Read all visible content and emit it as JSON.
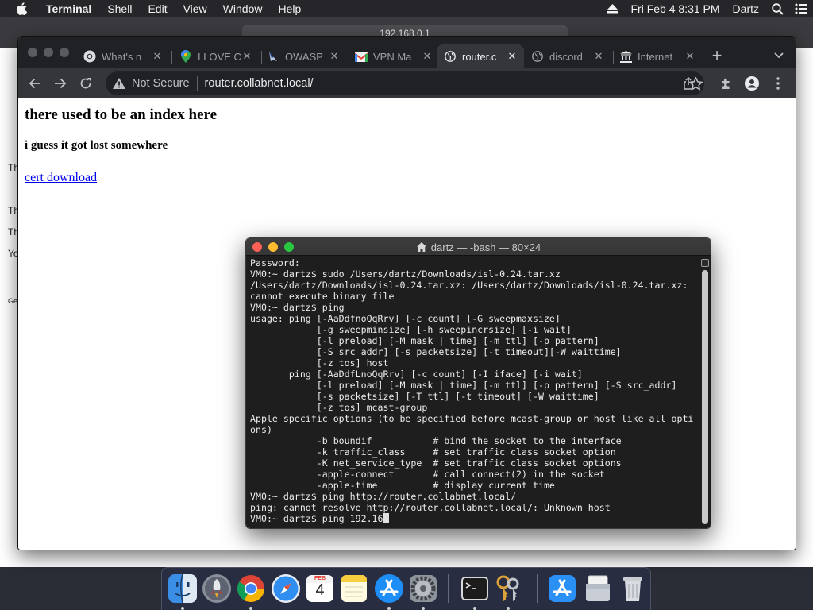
{
  "menubar": {
    "app_name": "Terminal",
    "menus": [
      "Shell",
      "Edit",
      "View",
      "Window",
      "Help"
    ],
    "datetime": "Fri Feb 4  8:31 PM",
    "user": "Dartz"
  },
  "background_window": {
    "address": "192.168.0.1",
    "side_texts": [
      "Th",
      "Th",
      "Th",
      "Yo",
      "Ge"
    ]
  },
  "browser": {
    "tabs": [
      {
        "title": "What's n",
        "icon": "chrome-icon",
        "active": false
      },
      {
        "title": "I LOVE C",
        "icon": "maps-pin-icon",
        "active": false
      },
      {
        "title": "OWASP",
        "icon": "owasp-icon",
        "active": false
      },
      {
        "title": "VPN Ma",
        "icon": "gmail-icon",
        "active": false
      },
      {
        "title": "router.c",
        "icon": "globe-icon",
        "active": true
      },
      {
        "title": "discord",
        "icon": "globe-icon",
        "active": false
      },
      {
        "title": "Internet",
        "icon": "building-icon",
        "active": false
      }
    ],
    "security_label": "Not Secure",
    "url": "router.collabnet.local/",
    "page": {
      "heading": "there used to be an index here",
      "subheading": "i guess it got lost somewhere",
      "link": "cert download"
    }
  },
  "terminal": {
    "title": "dartz — -bash — 80×24",
    "lines": [
      "Password:",
      "VM0:~ dartz$ sudo /Users/dartz/Downloads/isl-0.24.tar.xz",
      "/Users/dartz/Downloads/isl-0.24.tar.xz: /Users/dartz/Downloads/isl-0.24.tar.xz:",
      "cannot execute binary file",
      "VM0:~ dartz$ ping",
      "usage: ping [-AaDdfnoQqRrv] [-c count] [-G sweepmaxsize]",
      "            [-g sweepminsize] [-h sweepincrsize] [-i wait]",
      "            [-l preload] [-M mask | time] [-m ttl] [-p pattern]",
      "            [-S src_addr] [-s packetsize] [-t timeout][-W waittime]",
      "            [-z tos] host",
      "       ping [-AaDdfLnoQqRrv] [-c count] [-I iface] [-i wait]",
      "            [-l preload] [-M mask | time] [-m ttl] [-p pattern] [-S src_addr]",
      "            [-s packetsize] [-T ttl] [-t timeout] [-W waittime]",
      "            [-z tos] mcast-group",
      "Apple specific options (to be specified before mcast-group or host like all opti",
      "ons)",
      "            -b boundif           # bind the socket to the interface",
      "            -k traffic_class     # set traffic class socket option",
      "            -K net_service_type  # set traffic class socket options",
      "            -apple-connect       # call connect(2) in the socket",
      "            -apple-time          # display current time",
      "VM0:~ dartz$ ping http://router.collabnet.local/",
      "ping: cannot resolve http://router.collabnet.local/: Unknown host"
    ],
    "current_input": "VM0:~ dartz$ ping 192.16"
  },
  "dock": {
    "items": [
      "finder-icon",
      "launchpad-icon",
      "chrome-icon",
      "safari-icon",
      "calendar-icon",
      "notes-icon",
      "app-store-icon",
      "system-preferences-icon",
      "terminal-icon",
      "keychain-icon",
      "app-store-download-icon",
      "documents-folder-icon",
      "trash-icon"
    ],
    "calendar_month": "FEB",
    "calendar_day": "4"
  },
  "colors": {
    "link": "#0000ee",
    "chrome_dark": "#202124",
    "chrome_toolbar": "#35363a",
    "terminal_bg": "#1e1e1e"
  }
}
